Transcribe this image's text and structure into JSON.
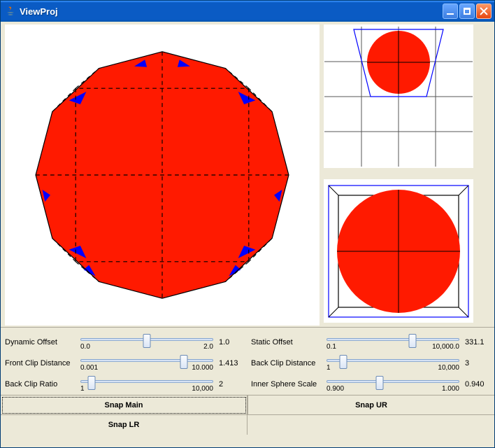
{
  "window": {
    "title": "ViewProj"
  },
  "sliders": {
    "dynamic_offset": {
      "label": "Dynamic Offset",
      "min": "0.0",
      "max": "2.0",
      "value": "1.0",
      "thumb_pct": 50
    },
    "static_offset": {
      "label": "Static Offset",
      "min": "0.1",
      "max": "10,000.0",
      "value": "331.1",
      "thumb_pct": 65
    },
    "front_clip": {
      "label": "Front Clip Distance",
      "min": "0.001",
      "max": "10.000",
      "value": "1.413",
      "thumb_pct": 78
    },
    "back_clip_dist": {
      "label": "Back Clip Distance",
      "min": "1",
      "max": "10,000",
      "value": "3",
      "thumb_pct": 12
    },
    "back_clip_ratio": {
      "label": "Back Clip Ratio",
      "min": "1",
      "max": "10,000",
      "value": "2",
      "thumb_pct": 8
    },
    "inner_sphere": {
      "label": "Inner Sphere Scale",
      "min": "0.900",
      "max": "1.000",
      "value": "0.940",
      "thumb_pct": 40
    }
  },
  "buttons": {
    "snap_main": "Snap Main",
    "snap_ur": "Snap UR",
    "snap_lr": "Snap LR"
  },
  "chart_data": {
    "type": "diagram",
    "main_view": {
      "description": "perspective projection of spherical object inside view frustum",
      "outer_polygon_sides": 12,
      "fill_color": "#ff1a00",
      "accent_color": "#0000ff",
      "edge_style": "dashed"
    },
    "upper_right_view": {
      "description": "top-down orthographic view, frustum trapezoid with circle",
      "circle_color": "#ff1a00",
      "frustum_color": "#0000ff",
      "grid": true
    },
    "lower_right_view": {
      "description": "front orthographic view, frustum outline with circle",
      "circle_color": "#ff1a00",
      "frustum_color": "#0000ff"
    }
  }
}
